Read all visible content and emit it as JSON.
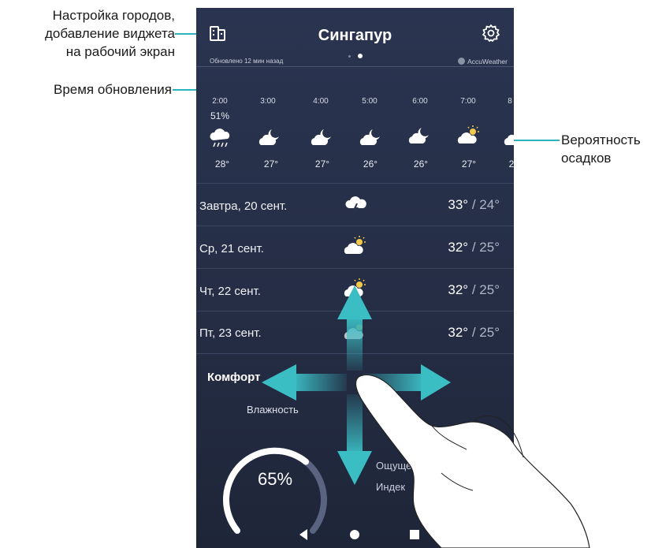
{
  "annotations": {
    "city_setup": [
      "Настройка городов,",
      "добавление виджета",
      "на рабочий экран"
    ],
    "update_time": "Время обновления",
    "precipitation": [
      "Вероятность",
      "осадков"
    ]
  },
  "header": {
    "title": "Сингапур",
    "city_list_icon": "city-list-icon",
    "settings_icon": "gear-icon"
  },
  "status": {
    "updated": "Обновлено 12 мин назад",
    "provider": "AccuWeather"
  },
  "hourly": {
    "precip_probability": "51%",
    "hours": [
      "2:00",
      "3:00",
      "4:00",
      "5:00",
      "6:00",
      "7:00",
      "8"
    ],
    "temps": [
      "28°",
      "27°",
      "27°",
      "26°",
      "26°",
      "27°",
      "2"
    ],
    "icons": [
      "rain-cloud-icon",
      "moon-cloud-icon",
      "moon-cloud-icon",
      "moon-cloud-icon",
      "moon-cloud-icon",
      "sun-cloud-icon",
      "cloud-icon"
    ]
  },
  "daily": [
    {
      "day": "Завтра, 20 сент.",
      "hi": "33°",
      "lo": " / 24°",
      "icon": "thunderstorm-icon"
    },
    {
      "day": "Ср, 21 сент.",
      "hi": "32°",
      "lo": " / 25°",
      "icon": "sun-cloud-icon"
    },
    {
      "day": "Чт, 22 сент.",
      "hi": "32°",
      "lo": " / 25°",
      "icon": "sun-cloud-icon"
    },
    {
      "day": "Пт, 23 сент.",
      "hi": "32°",
      "lo": " / 25°",
      "icon": "sun-cloud-icon"
    }
  ],
  "comfort": {
    "title": "Комфорт",
    "humidity_label": "Влажность",
    "humidity_value": "65%",
    "humidity_fraction": 0.65,
    "feels": "Ощущен",
    "index": "Индек"
  },
  "nav": {
    "back_icon": "back-triangle-icon",
    "home_icon": "home-circle-icon",
    "recent_icon": "recent-square-icon"
  },
  "gesture": {
    "arrows_icon": "four-way-arrows-icon",
    "hand_icon": "swipe-hand-icon"
  },
  "colors": {
    "accent": "#2bb3c0",
    "background": "#262f47"
  }
}
